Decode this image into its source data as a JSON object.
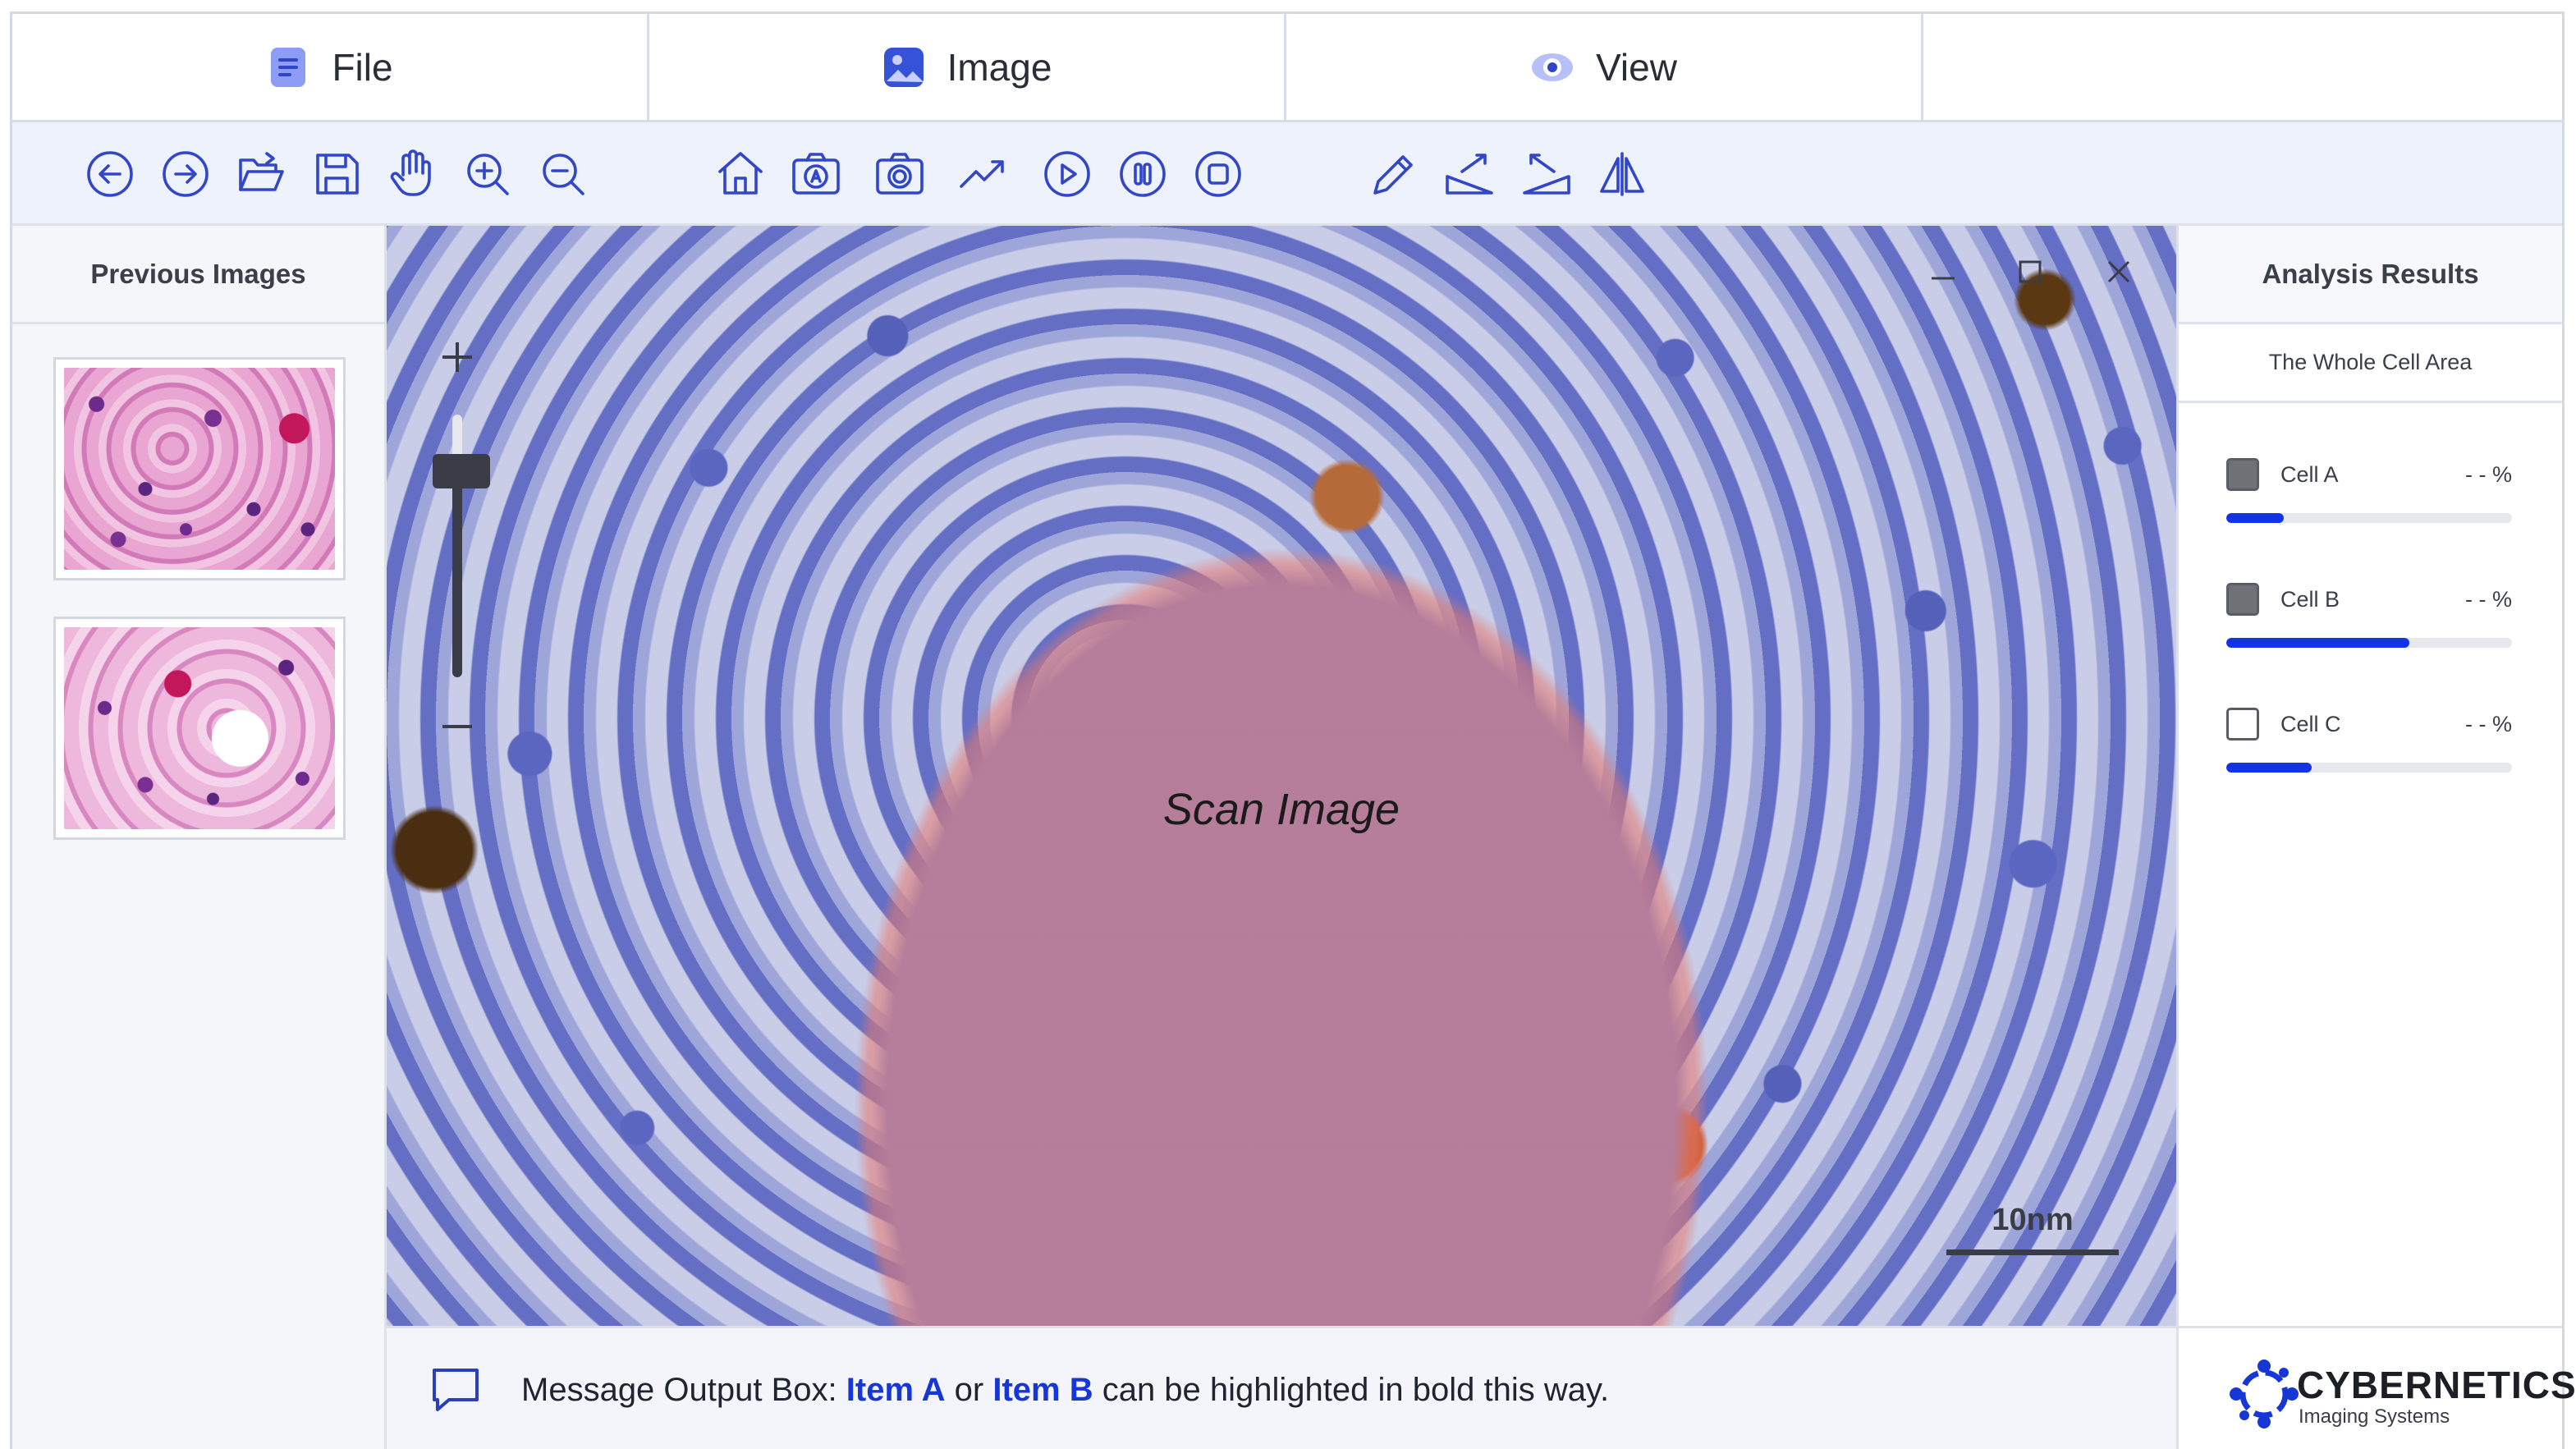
{
  "menu": {
    "tabs": [
      {
        "label": "File",
        "icon": "file-icon"
      },
      {
        "label": "Image",
        "icon": "image-icon"
      },
      {
        "label": "View",
        "icon": "eye-icon"
      }
    ]
  },
  "toolbar": {
    "tools": [
      "back",
      "forward",
      "open-folder",
      "save",
      "pan-hand",
      "zoom-in",
      "zoom-out",
      "home",
      "auto-capture",
      "camera",
      "trend",
      "play",
      "pause",
      "stop",
      "pencil",
      "ramp-up",
      "ramp-down",
      "flip"
    ]
  },
  "left_panel": {
    "title": "Previous Images",
    "thumbnails": [
      "thumbnail-1",
      "thumbnail-2"
    ]
  },
  "viewer": {
    "label": "Scan Image",
    "scale_label": "10nm",
    "zoom_level": 0.78
  },
  "analysis": {
    "title": "Analysis Results",
    "subtitle": "The Whole Cell Area",
    "cells": [
      {
        "name": "Cell A",
        "value": "- - %",
        "checked": true,
        "progress": 0.2
      },
      {
        "name": "Cell B",
        "value": "- - %",
        "checked": true,
        "progress": 0.64
      },
      {
        "name": "Cell C",
        "value": "- - %",
        "checked": false,
        "progress": 0.3
      }
    ]
  },
  "message": {
    "prefix": "Message Output Box: ",
    "item_a": "Item A",
    "middle": " or ",
    "item_b": "Item B",
    "suffix": " can be highlighted in bold this way."
  },
  "brand": {
    "name": "CYBERNETICS",
    "tagline": "Imaging Systems"
  },
  "colors": {
    "accent": "#1432e6",
    "toolbar_bg": "#eef2fd",
    "icon_blue": "#3146c9"
  }
}
